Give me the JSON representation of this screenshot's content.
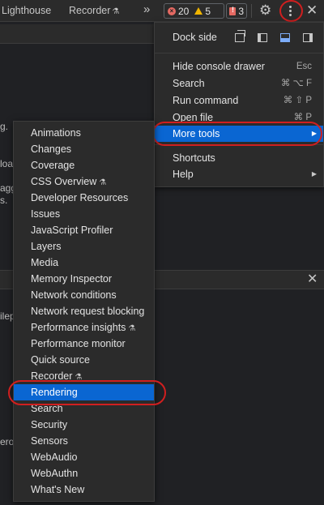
{
  "toolbar": {
    "tabs": [
      {
        "label": "Lighthouse"
      },
      {
        "label": "Recorder",
        "icon": "flask-icon"
      }
    ],
    "overflow_label": "»",
    "errors_count": "20",
    "warnings_count": "5",
    "issues_count": "3"
  },
  "background": {
    "fragments": [
      "g.",
      "loa",
      "agg",
      "s.",
      "ilep",
      "erol"
    ]
  },
  "main_menu": {
    "dock_side_label": "Dock side",
    "items": [
      {
        "label": "Hide console drawer",
        "shortcut": "Esc"
      },
      {
        "label": "Search",
        "shortcut": "⌘ ⌥ F"
      },
      {
        "label": "Run command",
        "shortcut": "⌘ ⇧ P"
      },
      {
        "label": "Open file",
        "shortcut": "⌘ P"
      },
      {
        "label": "More tools",
        "selected": true,
        "has_submenu": true
      },
      {
        "label": "Shortcuts"
      },
      {
        "label": "Help",
        "has_submenu": true
      }
    ]
  },
  "more_tools_menu": {
    "items": [
      {
        "label": "Animations"
      },
      {
        "label": "Changes"
      },
      {
        "label": "Coverage"
      },
      {
        "label": "CSS Overview",
        "experimental": true
      },
      {
        "label": "Developer Resources"
      },
      {
        "label": "Issues"
      },
      {
        "label": "JavaScript Profiler"
      },
      {
        "label": "Layers"
      },
      {
        "label": "Media"
      },
      {
        "label": "Memory Inspector"
      },
      {
        "label": "Network conditions"
      },
      {
        "label": "Network request blocking"
      },
      {
        "label": "Performance insights",
        "experimental": true
      },
      {
        "label": "Performance monitor"
      },
      {
        "label": "Quick source"
      },
      {
        "label": "Recorder",
        "experimental": true
      },
      {
        "label": "Rendering",
        "selected": true
      },
      {
        "label": "Search"
      },
      {
        "label": "Security"
      },
      {
        "label": "Sensors"
      },
      {
        "label": "WebAudio"
      },
      {
        "label": "WebAuthn"
      },
      {
        "label": "What's New"
      }
    ]
  },
  "colors": {
    "selection": "#0a66d2",
    "highlight_ring": "#d01f1f",
    "panel_bg": "#2b2b2b",
    "page_bg": "#202124"
  }
}
